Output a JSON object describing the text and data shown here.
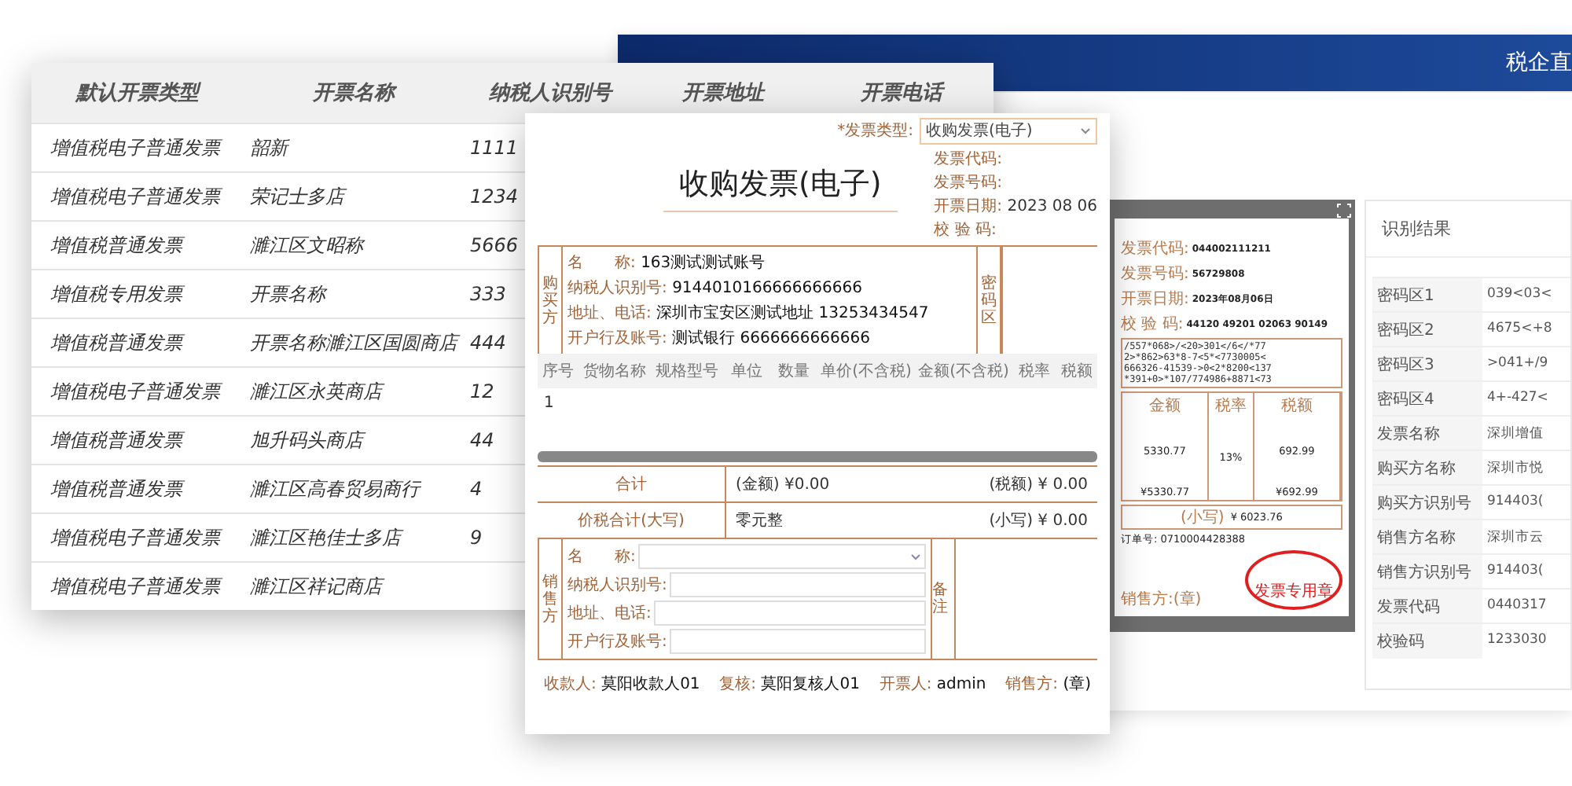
{
  "back_window": {
    "title": "税企直",
    "scan": {
      "fields": [
        {
          "label": "发票代码:",
          "value": "044002111211"
        },
        {
          "label": "发票号码:",
          "value": "56729808"
        },
        {
          "label": "开票日期:",
          "value": "2023年08月06日"
        },
        {
          "label": "校 验 码:",
          "value": "44120 49201 02063 90149"
        }
      ],
      "cipher": [
        "/557*068>/<20>301</6</*77",
        "2>*862>63*8-7<5*<7730005<",
        "666326-41539->0<2*8200<137",
        "*391+0>*107/774986+8871<73"
      ],
      "columns": [
        {
          "label": "金额",
          "value": "5330.77",
          "total": "¥5330.77"
        },
        {
          "label": "税率",
          "value": "13%"
        },
        {
          "label": "税额",
          "value": "692.99",
          "total": "¥692.99"
        }
      ],
      "small_label": "(小写)",
      "grand_total": "¥ 6023.76",
      "order": "订单号: 0710004428388",
      "seller": "销售方:(章)",
      "stamp": "发票专用章"
    },
    "results": {
      "title": "识别结果",
      "rows": [
        {
          "label": "密码区1",
          "value": "039<03<"
        },
        {
          "label": "密码区2",
          "value": "4675<+8"
        },
        {
          "label": "密码区3",
          "value": ">041+/9"
        },
        {
          "label": "密码区4",
          "value": "4+-427<"
        },
        {
          "label": "发票名称",
          "value": "深圳增值"
        },
        {
          "label": "购买方名称",
          "value": "深圳市悦"
        },
        {
          "label": "购买方识别号",
          "value": "914403("
        },
        {
          "label": "销售方名称",
          "value": "深圳市云"
        },
        {
          "label": "销售方识别号",
          "value": "914403("
        },
        {
          "label": "发票代码",
          "value": "0440317"
        },
        {
          "label": "校验码",
          "value": "1233030"
        }
      ]
    }
  },
  "table": {
    "columns": [
      "默认开票类型",
      "开票名称",
      "纳税人识别号",
      "开票地址",
      "开票电话"
    ],
    "rows": [
      {
        "type": "增值税电子普通发票",
        "name": "韶新",
        "tax_id": "1111"
      },
      {
        "type": "增值税电子普通发票",
        "name": "荣记士多店",
        "tax_id": "1234"
      },
      {
        "type": "增值税普通发票",
        "name": "濉江区文昭称",
        "tax_id": "5666"
      },
      {
        "type": "增值税专用发票",
        "name": "开票名称",
        "tax_id": "333"
      },
      {
        "type": "增值税普通发票",
        "name": "开票名称濉江区国圆商店",
        "tax_id": "444"
      },
      {
        "type": "增值税电子普通发票",
        "name": "濉江区永英商店",
        "tax_id": "12"
      },
      {
        "type": "增值税普通发票",
        "name": "旭升码头商店",
        "tax_id": "44"
      },
      {
        "type": "增值税普通发票",
        "name": "濉江区高春贸易商行",
        "tax_id": "4"
      },
      {
        "type": "增值税电子普通发票",
        "name": "濉江区艳佳士多店",
        "tax_id": "9"
      },
      {
        "type": "增值税电子普通发票",
        "name": "濉江区祥记商店"
      }
    ]
  },
  "invoice_form": {
    "type_label": "*发票类型:",
    "type_value": "收购发票(电子)",
    "title": "收购发票(电子)",
    "meta": [
      {
        "label": "发票代码:"
      },
      {
        "label": "发票号码:"
      },
      {
        "label": "开票日期:",
        "value": "2023 08 06"
      },
      {
        "label": "校 验 码:"
      }
    ],
    "buyer": {
      "side": "购买方",
      "lines": [
        {
          "label": "名　　称:",
          "value": "163测试测试账号"
        },
        {
          "label": "纳税人识别号:",
          "value": "9144010166666666666"
        },
        {
          "label": "地址、电话:",
          "value": "深圳市宝安区测试地址 13253434547"
        },
        {
          "label": "开户行及账号:",
          "value": "测试银行 6666666666666"
        }
      ]
    },
    "password_area": "密码区",
    "items": {
      "columns": [
        "序号",
        "货物名称",
        "规格型号",
        "单位",
        "数量",
        "单价(不含税)",
        "金额(不含税)",
        "税率",
        "税额"
      ],
      "rows": [
        [
          "1"
        ]
      ]
    },
    "totals": [
      {
        "label": "合计",
        "left": "(金额) ¥0.00",
        "right": "(税额) ¥ 0.00"
      },
      {
        "label": "价税合计(大写)",
        "left": "零元整",
        "right": "(小写) ¥ 0.00"
      }
    ],
    "seller": {
      "side": "销售方",
      "fields": [
        {
          "label": "名　　称:",
          "kind": "select"
        },
        {
          "label": "纳税人识别号:",
          "kind": "text"
        },
        {
          "label": "地址、电话:",
          "kind": "text"
        },
        {
          "label": "开户行及账号:",
          "kind": "text"
        }
      ],
      "remark": "备注"
    },
    "footer": [
      {
        "label": "收款人:",
        "value": "莫阳收款人01"
      },
      {
        "label": "复核:",
        "value": "莫阳复核人01"
      },
      {
        "label": "开票人:",
        "value": "admin"
      },
      {
        "label": "销售方:",
        "value": "(章)"
      }
    ]
  }
}
